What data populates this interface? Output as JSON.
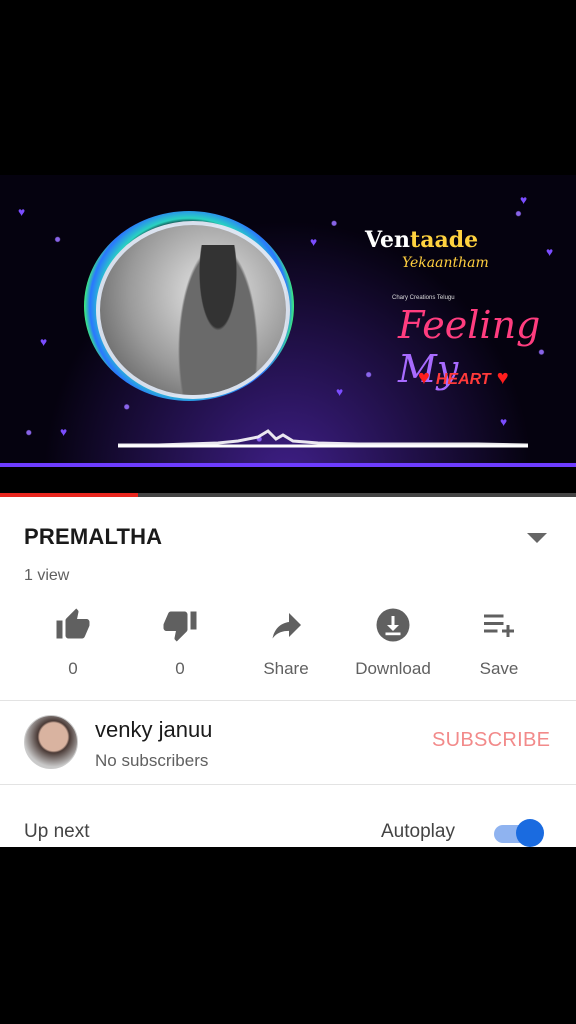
{
  "player": {
    "overlay": {
      "title_part1": "Ven",
      "title_part2": "taade",
      "subtitle": "Yekaantham",
      "credit": "Chary Creations Telugu",
      "feeling": "Feeling",
      "my": "My",
      "heart": "HEART"
    },
    "progress_fraction": 0.24
  },
  "video": {
    "title": "PREMALTHA",
    "views": "1 view"
  },
  "actions": [
    {
      "name": "like",
      "icon": "thumbs-up-icon",
      "label": "0"
    },
    {
      "name": "dislike",
      "icon": "thumbs-down-icon",
      "label": "0"
    },
    {
      "name": "share",
      "icon": "share-arrow-icon",
      "label": "Share"
    },
    {
      "name": "download",
      "icon": "download-icon",
      "label": "Download"
    },
    {
      "name": "save",
      "icon": "playlist-add-icon",
      "label": "Save"
    }
  ],
  "channel": {
    "name": "venky januu",
    "subscribers": "No subscribers",
    "subscribe_label": "SUBSCRIBE"
  },
  "up_next": {
    "label": "Up next",
    "autoplay_label": "Autoplay",
    "autoplay_on": true
  },
  "colors": {
    "subscribe": "#f28a8a",
    "toggle_knob": "#1a6be0",
    "scrub_progress": "#e8261e",
    "player_accent": "#6e3cff"
  }
}
